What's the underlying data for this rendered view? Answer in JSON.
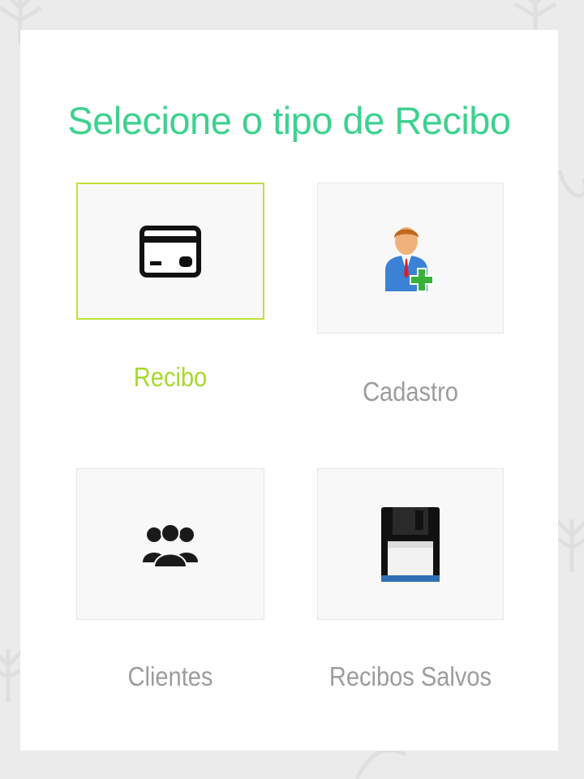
{
  "page": {
    "title": "Selecione o tipo de Recibo"
  },
  "options": [
    {
      "label": "Recibo",
      "icon": "credit-card-icon",
      "selected": true
    },
    {
      "label": "Cadastro",
      "icon": "add-user-icon",
      "selected": false
    },
    {
      "label": "Clientes",
      "icon": "users-group-icon",
      "selected": false
    },
    {
      "label": "Recibos Salvos",
      "icon": "floppy-disk-icon",
      "selected": false
    }
  ],
  "colors": {
    "title": "#3dd18f",
    "selected_accent": "#a6d92c",
    "label": "#9c9c9c",
    "background": "#ebebeb",
    "card": "#ffffff"
  }
}
